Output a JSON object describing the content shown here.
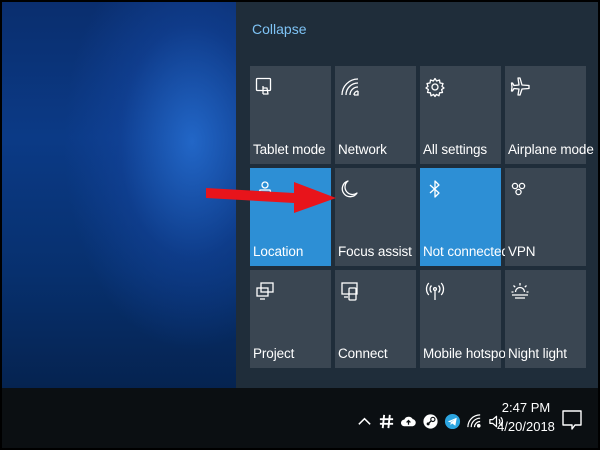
{
  "action_center": {
    "collapse_label": "Collapse",
    "tiles": [
      {
        "label": "Tablet mode",
        "icon": "tablet-mode-icon",
        "active": false
      },
      {
        "label": "Network",
        "icon": "network-icon",
        "active": false
      },
      {
        "label": "All settings",
        "icon": "gear-icon",
        "active": false
      },
      {
        "label": "Airplane mode",
        "icon": "airplane-icon",
        "active": false
      },
      {
        "label": "Location",
        "icon": "location-icon",
        "active": true
      },
      {
        "label": "Focus assist",
        "icon": "moon-icon",
        "active": false
      },
      {
        "label": "Not connected",
        "icon": "bluetooth-icon",
        "active": true
      },
      {
        "label": "VPN",
        "icon": "vpn-icon",
        "active": false
      },
      {
        "label": "Project",
        "icon": "project-icon",
        "active": false
      },
      {
        "label": "Connect",
        "icon": "connect-icon",
        "active": false
      },
      {
        "label": "Mobile hotspot",
        "icon": "hotspot-icon",
        "active": false
      },
      {
        "label": "Night light",
        "icon": "sun-icon",
        "active": false
      }
    ],
    "active_color": "#2d8fd5",
    "tile_color": "#3a4652"
  },
  "taskbar": {
    "tray_icons": [
      "chevron-up-icon",
      "slack-icon",
      "cloud-upload-icon",
      "steam-icon",
      "telegram-icon",
      "wifi-icon",
      "volume-icon"
    ],
    "time": "2:47 PM",
    "date": "4/20/2018",
    "notification_icon": "action-center-icon"
  },
  "annotation": {
    "color": "#e8141b",
    "points_to": "Focus assist"
  }
}
